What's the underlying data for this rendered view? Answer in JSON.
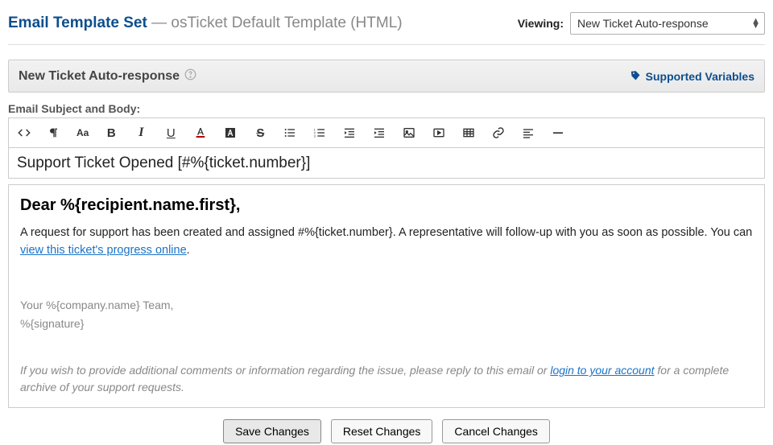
{
  "header": {
    "title": "Email Template Set",
    "subtitle": "— osTicket Default Template (HTML)",
    "viewing_label": "Viewing:",
    "dropdown_value": "New Ticket Auto-response"
  },
  "section": {
    "title": "New Ticket Auto-response",
    "supported_vars": "Supported Variables"
  },
  "subject_body_label": "Email Subject and Body:",
  "subject_value": "Support Ticket Opened [#%{ticket.number}]",
  "editor": {
    "greeting": "Dear %{recipient.name.first},",
    "body_prefix": "A request for support has been created and assigned #%{ticket.number}. A representative will follow-up with you as soon as possible. You can ",
    "body_link": "view this ticket's progress online",
    "body_suffix": ".",
    "sig_line1": "Your %{company.name} Team,",
    "sig_line2": "%{signature}",
    "footer_prefix": "If you wish to provide additional comments or information regarding the issue, please reply to this email or ",
    "footer_link": "login to your account",
    "footer_suffix": " for a complete archive of your support requests."
  },
  "buttons": {
    "save": "Save Changes",
    "reset": "Reset Changes",
    "cancel": "Cancel Changes"
  }
}
